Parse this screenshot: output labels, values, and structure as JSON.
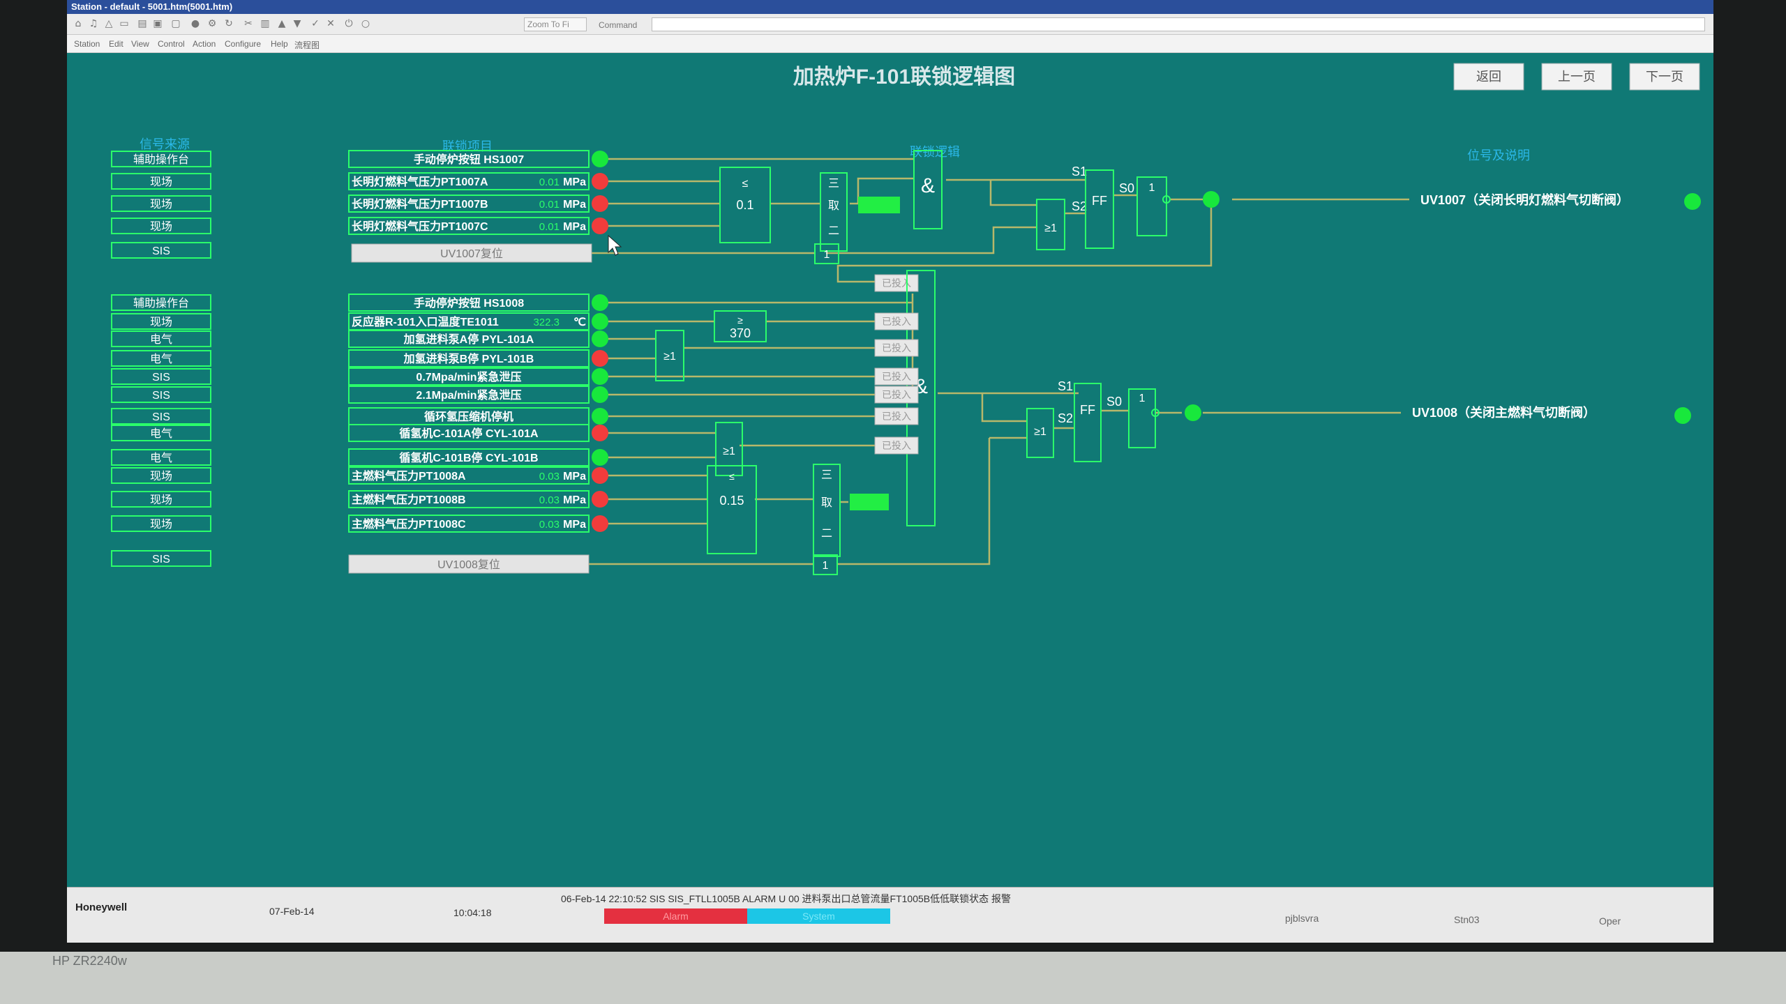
{
  "window": {
    "title": "Station - default - 5001.htm(5001.htm)"
  },
  "toolbar": {
    "zoom": "Zoom To Fi",
    "command_label": "Command"
  },
  "menu": [
    "Station",
    "Edit",
    "View",
    "Control",
    "Action",
    "Configure",
    "Help",
    "流程图"
  ],
  "page": {
    "title": "加热炉F-101联锁逻辑图",
    "back": "返回",
    "prev": "上一页",
    "next": "下一页"
  },
  "headers": {
    "source": "信号来源",
    "item": "联锁项目",
    "logic": "联锁逻辑",
    "output": "位号及说明"
  },
  "colors": {
    "background": "#107975",
    "line": "#b8b86a",
    "frame": "#2bff6a",
    "green_lamp": "#18e83c",
    "red_lamp": "#f23c3c",
    "value": "#2bff6a"
  },
  "section1": {
    "rows": [
      {
        "source": "辅助操作台",
        "label": "手动停炉按钮 HS1007",
        "value": "",
        "unit": "",
        "status": "green"
      },
      {
        "source": "现场",
        "label": "长明灯燃料气压力PT1007A",
        "value": "0.01",
        "unit": "MPa",
        "status": "red"
      },
      {
        "source": "现场",
        "label": "长明灯燃料气压力PT1007B",
        "value": "0.01",
        "unit": "MPa",
        "status": "red"
      },
      {
        "source": "现场",
        "label": "长明灯燃料气压力PT1007C",
        "value": "0.01",
        "unit": "MPa",
        "status": "red"
      }
    ],
    "reset_source": "SIS",
    "reset_button": "UV1007复位",
    "cmp_op": "≤",
    "cmp_val": "0.1",
    "vote": [
      "三",
      "取",
      "二"
    ],
    "and_sym": "&",
    "or_sym": "≥1",
    "ff": "FF",
    "s1": "S1",
    "s2": "S2",
    "s0": "S0",
    "one": "1",
    "output": "UV1007（关闭长明灯燃料气切断阀）",
    "output_status": "green"
  },
  "section2": {
    "rows": [
      {
        "source": "辅助操作台",
        "label": "手动停炉按钮 HS1008",
        "value": "",
        "unit": "",
        "status": "green"
      },
      {
        "source": "现场",
        "label": "反应器R-101入口温度TE1011",
        "value": "322.3",
        "unit": "℃",
        "status": "green"
      },
      {
        "source": "电气",
        "label": "加氢进料泵A停 PYL-101A",
        "value": "",
        "unit": "",
        "status": "green"
      },
      {
        "source": "电气",
        "label": "加氢进料泵B停 PYL-101B",
        "value": "",
        "unit": "",
        "status": "red"
      },
      {
        "source": "SIS",
        "label": "0.7Mpa/min紧急泄压",
        "value": "",
        "unit": "",
        "status": "green"
      },
      {
        "source": "SIS",
        "label": "2.1Mpa/min紧急泄压",
        "value": "",
        "unit": "",
        "status": "green"
      },
      {
        "source": "SIS",
        "label": "循环氢压缩机停机",
        "value": "",
        "unit": "",
        "status": "green"
      },
      {
        "source": "电气",
        "label": "循氢机C-101A停 CYL-101A",
        "value": "",
        "unit": "",
        "status": "red"
      },
      {
        "source": "电气",
        "label": "循氢机C-101B停 CYL-101B",
        "value": "",
        "unit": "",
        "status": "green"
      },
      {
        "source": "现场",
        "label": "主燃料气压力PT1008A",
        "value": "0.03",
        "unit": "MPa",
        "status": "red"
      },
      {
        "source": "现场",
        "label": "主燃料气压力PT1008B",
        "value": "0.03",
        "unit": "MPa",
        "status": "red"
      },
      {
        "source": "现场",
        "label": "主燃料气压力PT1008C",
        "value": "0.03",
        "unit": "MPa",
        "status": "red"
      }
    ],
    "reset_source": "SIS",
    "reset_button": "UV1008复位",
    "temp_op": "≥",
    "temp_val": "370",
    "cmp_op": "≤",
    "cmp_val": "0.15",
    "vote": [
      "三",
      "取",
      "二"
    ],
    "bypass": "已投入",
    "output": "UV1008（关闭主燃料气切断阀）",
    "output_status": "green"
  },
  "statusbar": {
    "brand": "Honeywell",
    "date": "07-Feb-14",
    "time": "10:04:18",
    "alarm_message": "06-Feb-14  22:10:52  SIS   SIS_FTLL1005B  ALARM   U 00  进料泵出口总管流量FT1005B低低联锁状态   报警",
    "alarm_tab": "Alarm",
    "system_tab": "System",
    "server": "pjblsvra",
    "station": "Stn03",
    "level": "Oper"
  },
  "monitor": {
    "model": "HP ZR2240w"
  }
}
